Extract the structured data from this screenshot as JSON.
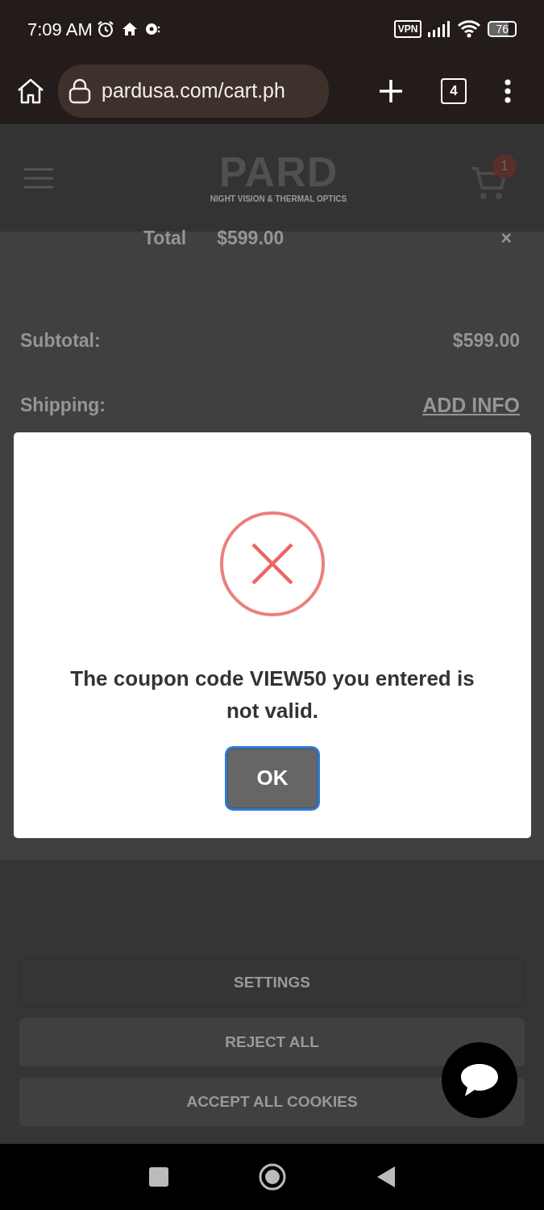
{
  "status_bar": {
    "time": "7:09 AM",
    "vpn": "VPN",
    "battery": "76"
  },
  "browser": {
    "url": "pardusa.com/cart.ph",
    "tab_count": "4"
  },
  "site_header": {
    "logo": "PARD",
    "tagline": "NIGHT VISION & THERMAL OPTICS",
    "cart_count": "1"
  },
  "cart": {
    "total_label": "Total",
    "total_value": "$599.00",
    "remove": "×",
    "subtotal_label": "Subtotal:",
    "subtotal_value": "$599.00",
    "shipping_label": "Shipping:",
    "shipping_action": "ADD INFO"
  },
  "dialog": {
    "message": "The coupon code VIEW50 you entered is not valid.",
    "button": {
      "label": "OK",
      "focused": true
    }
  },
  "cookie_buttons": [
    {
      "label": "SETTINGS",
      "kind": "outline"
    },
    {
      "label": "REJECT ALL",
      "kind": "filled"
    },
    {
      "label": "ACCEPT ALL COOKIES",
      "kind": "filled"
    }
  ]
}
